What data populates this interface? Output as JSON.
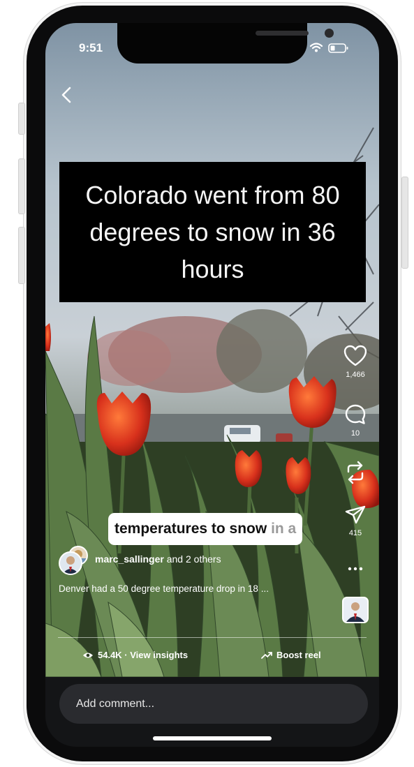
{
  "status_bar": {
    "time": "9:51"
  },
  "video": {
    "caption_overlay": "Colorado went from 80 degrees to snow in 36 hours",
    "subtitle": {
      "highlighted": "temperatures to snow",
      "dim": "in a"
    }
  },
  "actions": {
    "likes": "1,466",
    "comments": "10",
    "shares": "415"
  },
  "author": {
    "username": "marc_sallinger",
    "collaborators": "and 2 others"
  },
  "description": "Denver had a 50 degree temperature drop in 18 ...",
  "footer": {
    "views": "54.4K · View insights",
    "boost": "Boost reel"
  },
  "comment": {
    "placeholder": "Add comment..."
  },
  "icons": [
    "back-chevron-icon",
    "heart-icon",
    "comment-icon",
    "remix-icon",
    "send-icon",
    "more-icon",
    "eye-icon",
    "trend-up-icon",
    "wifi-icon",
    "battery-icon"
  ],
  "colors": {
    "bezel": "#0b0b0c",
    "comment_bar": "#2a2b2f",
    "tulip_red": "#d8311c",
    "caption_bg": "#000000"
  }
}
